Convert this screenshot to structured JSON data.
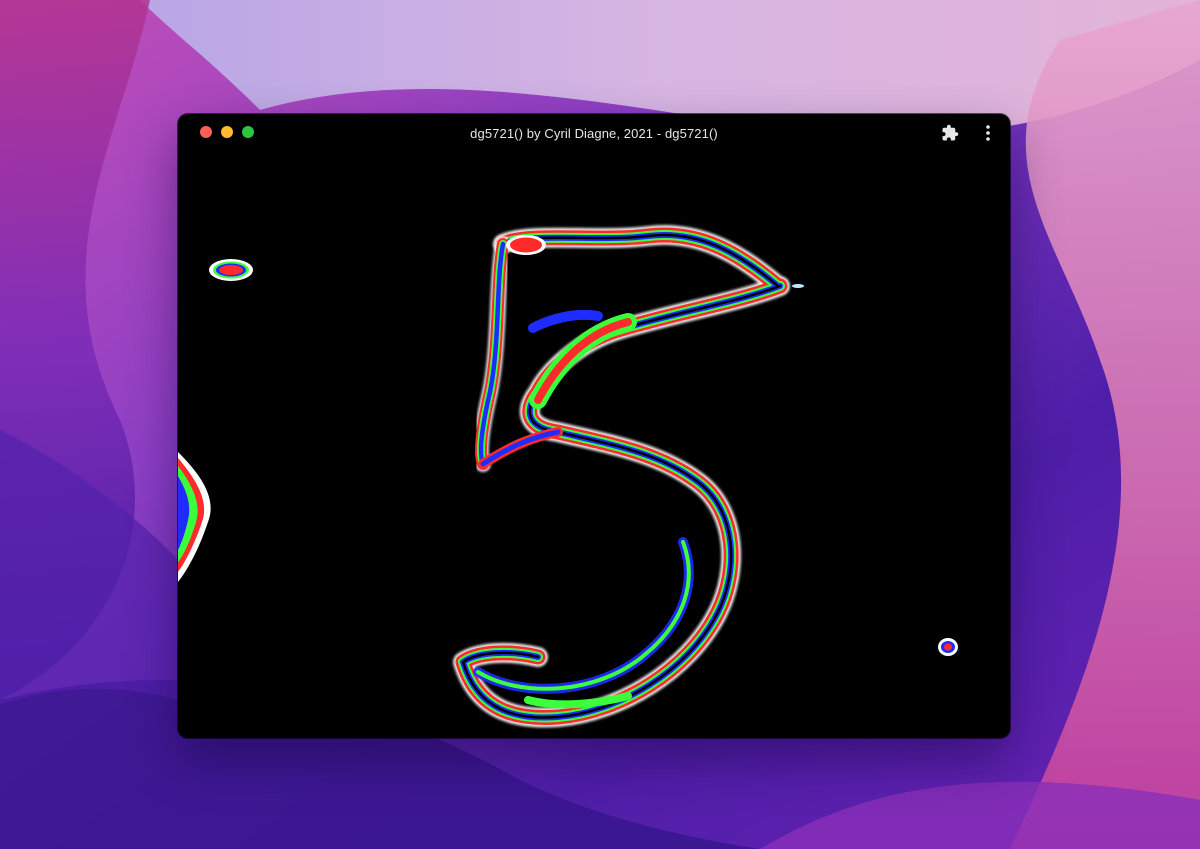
{
  "window": {
    "title": "dg5721() by Cyril Diagne, 2021 - dg5721()",
    "controls": [
      "close",
      "minimize",
      "zoom"
    ],
    "actions": [
      "puzzle-icon",
      "more-vertical-icon"
    ]
  },
  "colors": {
    "traffic_close": "#ff5f57",
    "traffic_minimize": "#febc2e",
    "traffic_zoom": "#28c840",
    "canvas_background": "#000000",
    "art_blue": "#1f2cff",
    "art_green": "#3cff3c",
    "art_red": "#ff2a2a"
  }
}
